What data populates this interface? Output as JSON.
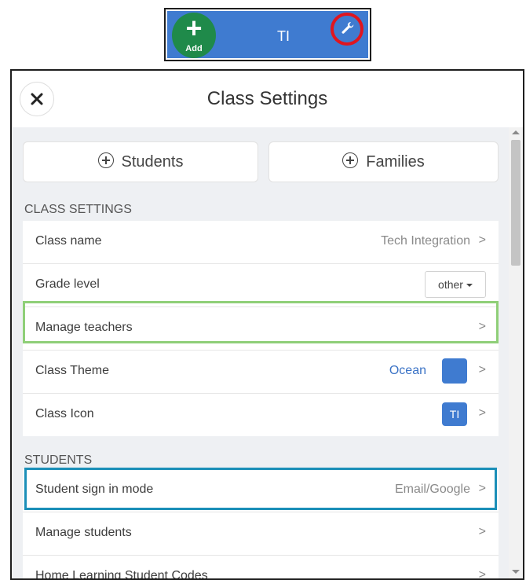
{
  "topbar": {
    "add_label": "Add",
    "add_icon": "plus-icon",
    "class_title": "TI",
    "settings_icon": "wrench-icon",
    "colors": {
      "bar": "#3f7bd0",
      "add": "#1f8a4a",
      "highlight": "#e0151f"
    }
  },
  "panel": {
    "close_icon": "close-icon",
    "title": "Class Settings",
    "add_buttons": [
      {
        "label": "Students",
        "icon": "plus-circle-icon"
      },
      {
        "label": "Families",
        "icon": "plus-circle-icon"
      }
    ],
    "class_settings": {
      "heading": "CLASS SETTINGS",
      "class_name": {
        "label": "Class name",
        "value": "Tech Integration",
        "chevron": ">"
      },
      "grade_level": {
        "label": "Grade level",
        "value": "other"
      },
      "manage_teachers": {
        "label": "Manage teachers",
        "chevron": ">"
      },
      "class_theme": {
        "label": "Class Theme",
        "value": "Ocean",
        "swatch_color": "#3f7bd0",
        "chevron": ">"
      },
      "class_icon": {
        "label": "Class Icon",
        "icon_text": "TI",
        "chevron": ">"
      }
    },
    "students": {
      "heading": "STUDENTS",
      "sign_in_mode": {
        "label": "Student sign in mode",
        "value": "Email/Google",
        "chevron": ">"
      },
      "manage_students": {
        "label": "Manage students",
        "chevron": ">"
      },
      "home_learning": {
        "label": "Home Learning Student Codes",
        "chevron": ">"
      }
    },
    "annotation_colors": {
      "green": "#8fcf78",
      "blue": "#1b8fb8"
    }
  }
}
